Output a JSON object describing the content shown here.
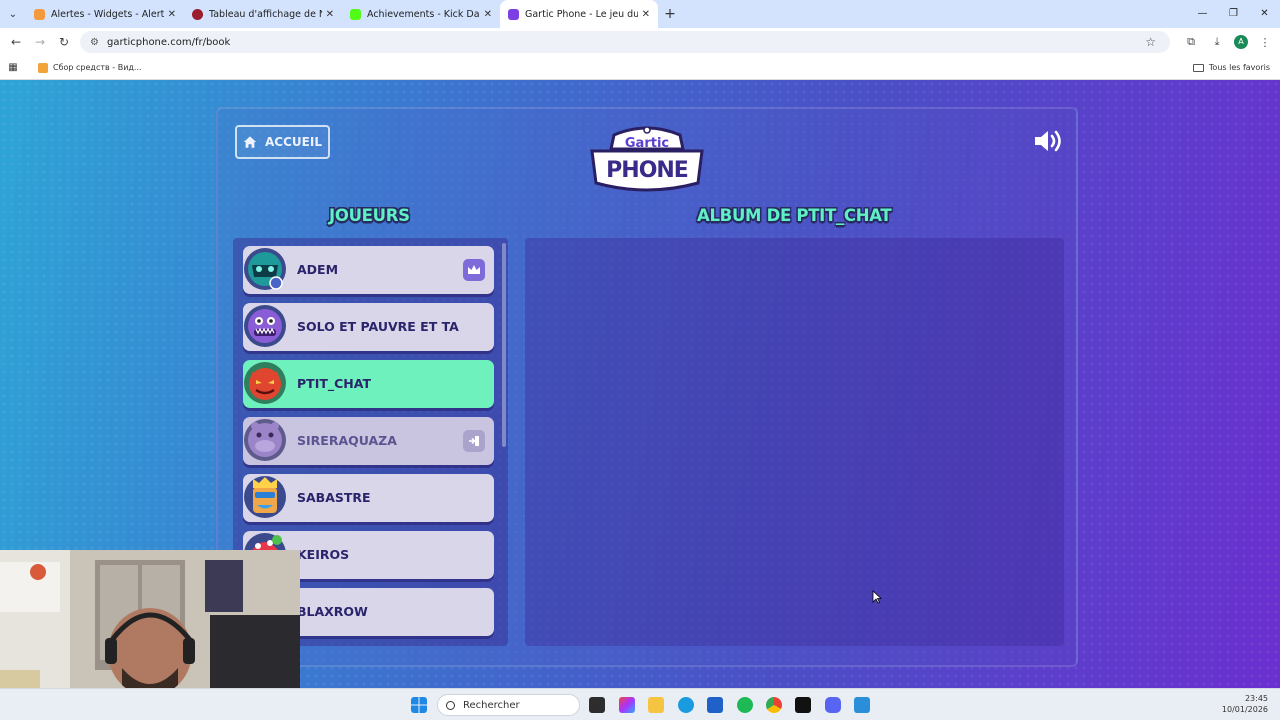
{
  "browser": {
    "tabs": [
      {
        "title": "Alertes - Widgets - Alertes de",
        "favicon_color": "#f29a3d",
        "active": false
      },
      {
        "title": "Tableau d'affichage de Naruto",
        "favicon_color": "#9b1c2c",
        "active": false
      },
      {
        "title": "Achievements - Kick Dashboard",
        "favicon_color": "#53fc18",
        "active": false
      },
      {
        "title": "Gartic Phone - Le jeu du téléph",
        "favicon_color": "#7b3fe4",
        "active": true
      }
    ],
    "url": "garticphone.com/fr/book",
    "profile_initial": "A",
    "bookmarks": [
      {
        "label": "Сбор средств - Вид..."
      }
    ],
    "all_bookmarks_label": "Tous les favoris"
  },
  "game": {
    "home_button_label": "ACCUEIL",
    "logo_top": "Gartic",
    "logo_bottom": "PHONE",
    "players_title": "JOUEURS",
    "album_title": "ALBUM DE PTIT_CHAT",
    "players": [
      {
        "name": "ADEM",
        "avatar": "teal-mask-avatar",
        "host": true,
        "state": "normal"
      },
      {
        "name": "SOLO ET PAUVRE ET TA",
        "avatar": "purple-monster-avatar",
        "host": false,
        "state": "normal"
      },
      {
        "name": "PTIT_CHAT",
        "avatar": "red-devil-avatar",
        "host": false,
        "state": "current"
      },
      {
        "name": "SIRERAQUAZA",
        "avatar": "purple-hippo-avatar",
        "host": false,
        "state": "left"
      },
      {
        "name": "SABASTRE",
        "avatar": "king-avatar",
        "host": false,
        "state": "normal"
      },
      {
        "name": "KEIROS",
        "avatar": "mushroom-avatar",
        "host": false,
        "state": "normal"
      },
      {
        "name": "BLAXROW",
        "avatar": "dark-avatar",
        "host": false,
        "state": "normal"
      }
    ],
    "accent_color": "#5ff0c4",
    "current_player_color": "#6ff1be"
  },
  "taskbar": {
    "search_placeholder": "Rechercher",
    "time": "23:45",
    "date": "10/01/2026"
  }
}
